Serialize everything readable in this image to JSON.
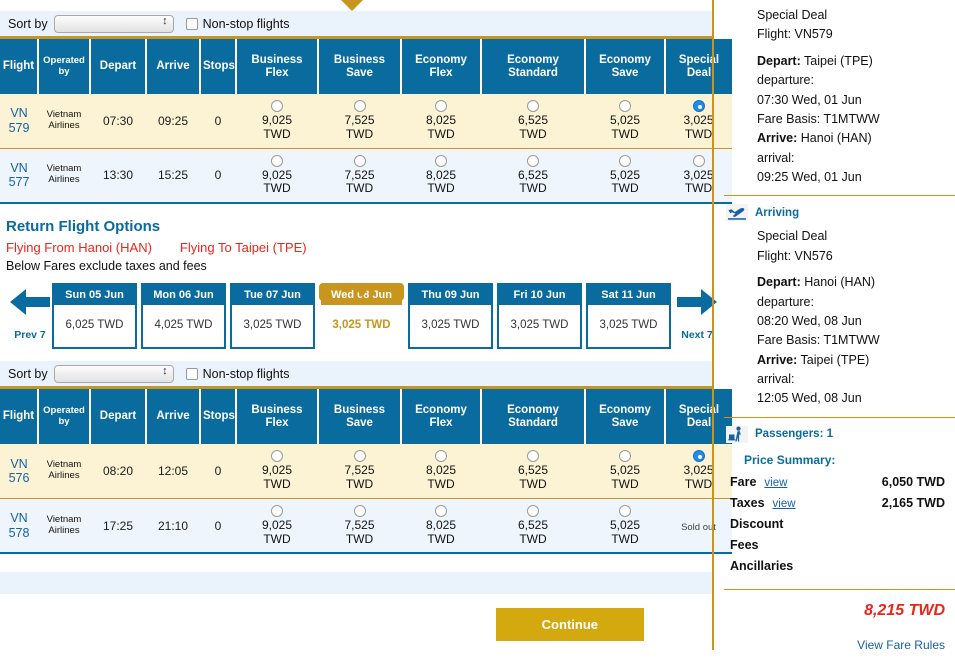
{
  "outbound": {
    "sort": {
      "label": "Sort by",
      "value": "",
      "nonstop_label": "Non-stop flights",
      "nonstop_checked": false
    },
    "columns": [
      "Flight",
      "Operated by",
      "Depart",
      "Arrive",
      "Stops",
      "Business Flex",
      "Business Save",
      "Economy Flex",
      "Economy Standard",
      "Economy Save",
      "Special Deal"
    ],
    "rows": [
      {
        "flight_code": "VN",
        "flight_num": "579",
        "operator_l1": "Vietnam",
        "operator_l2": "Airlines",
        "depart": "07:30",
        "arrive": "09:25",
        "stops": "0",
        "fares": [
          {
            "amount": "9,025",
            "currency": "TWD",
            "selected": false,
            "soldout": false
          },
          {
            "amount": "7,525",
            "currency": "TWD",
            "selected": false,
            "soldout": false
          },
          {
            "amount": "8,025",
            "currency": "TWD",
            "selected": false,
            "soldout": false
          },
          {
            "amount": "6,525",
            "currency": "TWD",
            "selected": false,
            "soldout": false
          },
          {
            "amount": "5,025",
            "currency": "TWD",
            "selected": false,
            "soldout": false
          },
          {
            "amount": "3,025",
            "currency": "TWD",
            "selected": true,
            "soldout": false
          }
        ]
      },
      {
        "flight_code": "VN",
        "flight_num": "577",
        "operator_l1": "Vietnam",
        "operator_l2": "Airlines",
        "depart": "13:30",
        "arrive": "15:25",
        "stops": "0",
        "fares": [
          {
            "amount": "9,025",
            "currency": "TWD",
            "selected": false,
            "soldout": false
          },
          {
            "amount": "7,525",
            "currency": "TWD",
            "selected": false,
            "soldout": false
          },
          {
            "amount": "8,025",
            "currency": "TWD",
            "selected": false,
            "soldout": false
          },
          {
            "amount": "6,525",
            "currency": "TWD",
            "selected": false,
            "soldout": false
          },
          {
            "amount": "5,025",
            "currency": "TWD",
            "selected": false,
            "soldout": false
          },
          {
            "amount": "3,025",
            "currency": "TWD",
            "selected": false,
            "soldout": false
          }
        ]
      }
    ]
  },
  "return_section": {
    "title": "Return Flight Options",
    "flying_from": "Flying From Hanoi (HAN)",
    "flying_to": "Flying To Taipei (TPE)",
    "note": "Below Fares exclude taxes and fees",
    "prev_label": "Prev 7",
    "next_label": "Next 7",
    "dates": [
      {
        "day": "Sun 05 Jun",
        "price": "6,025 TWD",
        "selected": false
      },
      {
        "day": "Mon 06 Jun",
        "price": "4,025 TWD",
        "selected": false
      },
      {
        "day": "Tue 07 Jun",
        "price": "3,025 TWD",
        "selected": false
      },
      {
        "day": "Wed 08 Jun",
        "price": "3,025 TWD",
        "selected": true
      },
      {
        "day": "Thu 09 Jun",
        "price": "3,025 TWD",
        "selected": false
      },
      {
        "day": "Fri 10 Jun",
        "price": "3,025 TWD",
        "selected": false
      },
      {
        "day": "Sat 11 Jun",
        "price": "3,025 TWD",
        "selected": false
      }
    ]
  },
  "inbound": {
    "sort": {
      "label": "Sort by",
      "value": "",
      "nonstop_label": "Non-stop flights",
      "nonstop_checked": false
    },
    "columns": [
      "Flight",
      "Operated by",
      "Depart",
      "Arrive",
      "Stops",
      "Business Flex",
      "Business Save",
      "Economy Flex",
      "Economy Standard",
      "Economy Save",
      "Special Deal"
    ],
    "rows": [
      {
        "flight_code": "VN",
        "flight_num": "576",
        "operator_l1": "Vietnam",
        "operator_l2": "Airlines",
        "depart": "08:20",
        "arrive": "12:05",
        "stops": "0",
        "fares": [
          {
            "amount": "9,025",
            "currency": "TWD",
            "selected": false,
            "soldout": false
          },
          {
            "amount": "7,525",
            "currency": "TWD",
            "selected": false,
            "soldout": false
          },
          {
            "amount": "8,025",
            "currency": "TWD",
            "selected": false,
            "soldout": false
          },
          {
            "amount": "6,525",
            "currency": "TWD",
            "selected": false,
            "soldout": false
          },
          {
            "amount": "5,025",
            "currency": "TWD",
            "selected": false,
            "soldout": false
          },
          {
            "amount": "3,025",
            "currency": "TWD",
            "selected": true,
            "soldout": false
          }
        ]
      },
      {
        "flight_code": "VN",
        "flight_num": "578",
        "operator_l1": "Vietnam",
        "operator_l2": "Airlines",
        "depart": "17:25",
        "arrive": "21:10",
        "stops": "0",
        "fares": [
          {
            "amount": "9,025",
            "currency": "TWD",
            "selected": false,
            "soldout": false
          },
          {
            "amount": "7,525",
            "currency": "TWD",
            "selected": false,
            "soldout": false
          },
          {
            "amount": "8,025",
            "currency": "TWD",
            "selected": false,
            "soldout": false
          },
          {
            "amount": "6,525",
            "currency": "TWD",
            "selected": false,
            "soldout": false
          },
          {
            "amount": "5,025",
            "currency": "TWD",
            "selected": false,
            "soldout": false
          },
          {
            "amount": "Sold out",
            "currency": "",
            "selected": false,
            "soldout": true
          }
        ]
      }
    ]
  },
  "continue_button": "Continue",
  "sidebar": {
    "departing": {
      "icon": "plane-depart-icon",
      "heading": "",
      "fare_name": "Special Deal",
      "flight": "Flight: VN579",
      "depart_label": "Depart:",
      "depart_value": "Taipei (TPE)",
      "departure_label": "departure:",
      "departure_value": "07:30 Wed, 01 Jun",
      "fare_basis": "Fare Basis: T1MTWW",
      "arrive_label": "Arrive:",
      "arrive_value": "Hanoi (HAN)",
      "arrival_label": "arrival:",
      "arrival_value": "09:25 Wed, 01 Jun"
    },
    "arriving": {
      "icon": "plane-arrive-icon",
      "heading": "Arriving",
      "fare_name": "Special Deal",
      "flight": "Flight: VN576",
      "depart_label": "Depart:",
      "depart_value": "Hanoi (HAN)",
      "departure_label": "departure:",
      "departure_value": "08:20 Wed, 08 Jun",
      "fare_basis": "Fare Basis: T1MTWW",
      "arrive_label": "Arrive:",
      "arrive_value": "Taipei (TPE)",
      "arrival_label": "arrival:",
      "arrival_value": "12:05 Wed, 08 Jun"
    },
    "passengers": {
      "icon": "passenger-icon",
      "text": "Passengers: 1"
    },
    "price_summary": {
      "title": "Price Summary:",
      "rows": [
        {
          "label": "Fare",
          "view": "view",
          "value": "6,050 TWD"
        },
        {
          "label": "Taxes",
          "view": "view",
          "value": "2,165 TWD"
        },
        {
          "label": "Discount",
          "view": "",
          "value": ""
        },
        {
          "label": "Fees",
          "view": "",
          "value": ""
        },
        {
          "label": "Ancillaries",
          "view": "",
          "value": ""
        }
      ],
      "total": "8,215 TWD"
    },
    "fare_rules_link": "View Fare Rules"
  },
  "colors": {
    "header_blue": "#0a6b9e",
    "gold": "#c8961e",
    "row_gold_bg": "#fcf3d4",
    "row_blue_bg": "#eef5fc",
    "red": "#e8261c",
    "link_blue": "#1560a8",
    "button_gold": "#d4a910"
  }
}
